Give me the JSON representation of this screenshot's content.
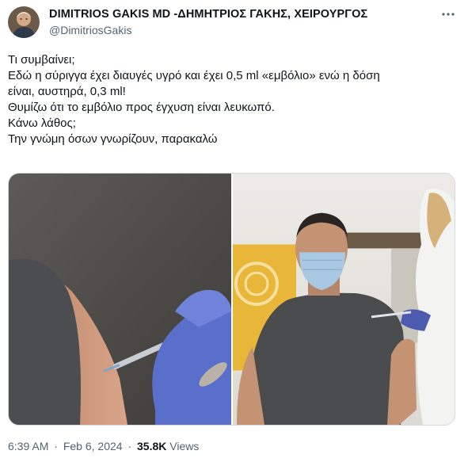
{
  "author": {
    "display_name": "DIMITRIOS GAKIS MD -ΔΗΜΗΤΡΙΟΣ ΓΑΚΗΣ, ΧΕΙΡΟΥΡΓΟΣ",
    "handle": "@DimitriosGakis",
    "avatar_icon": "avatar-photo"
  },
  "more_icon": "more-options-icon",
  "tweet_text": [
    "Τι συμβαίνει;",
    "Εδώ η σύριγγα έχει διαυγές υγρό και έχει 0,5 ml «εμβόλιο» ενώ η δόση",
    "είναι, αυστηρά, 0,3 ml!",
    "Θυμίζω ότι το εμβόλιο  προς έγχυση είναι λευκωπό.",
    "Κάνω λάθος;",
    "Την γνώμη όσων γνωρίζουν, παρακαλώ"
  ],
  "media": [
    {
      "alt": "syringe-injection-closeup"
    },
    {
      "alt": "man-receiving-vaccine"
    }
  ],
  "meta": {
    "time": "6:39 AM",
    "separator": "·",
    "date": "Feb 6, 2024",
    "views_count": "35.8K",
    "views_label": "Views"
  },
  "colors": {
    "text": "#0f1419",
    "secondary": "#536471",
    "border": "#cfd9de"
  }
}
